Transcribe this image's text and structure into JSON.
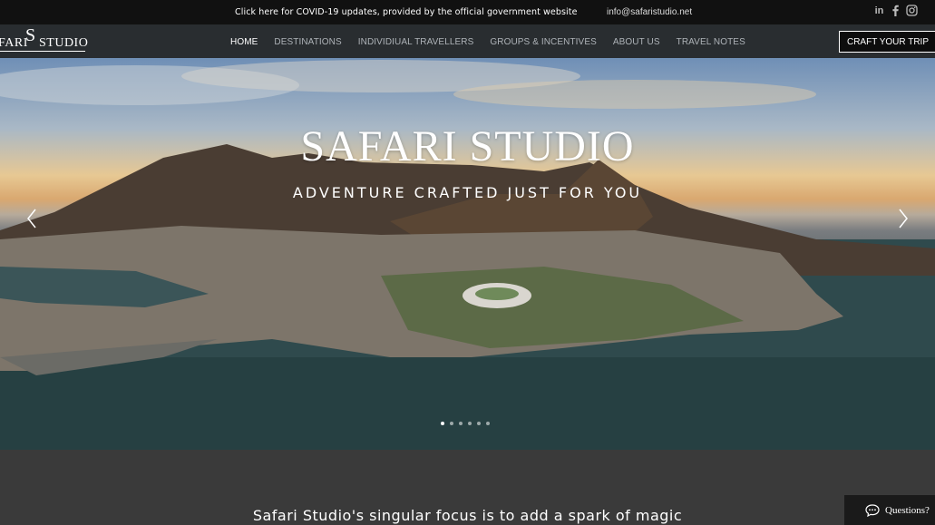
{
  "topbar": {
    "covid_text": "Click here for COVID-19 updates, provided by the official government website",
    "email": "info@safaristudio.net",
    "social": [
      "linkedin-icon",
      "facebook-icon",
      "instagram-icon"
    ]
  },
  "logo": {
    "initial": "S",
    "word1": "FARI",
    "word2": "STUDIO"
  },
  "nav": {
    "items": [
      "HOME",
      "DESTINATIONS",
      "INDIVIDIUAL TRAVELLERS",
      "GROUPS & INCENTIVES",
      "ABOUT US",
      "TRAVEL NOTES"
    ],
    "active_index": 0,
    "cta": "CRAFT YOUR TRIP"
  },
  "hero": {
    "title": "SAFARI STUDIO",
    "subtitle": "ADVENTURE CRAFTED JUST FOR YOU",
    "slide_count": 6,
    "active_slide": 0
  },
  "intro": {
    "text": "Safari Studio's singular focus is to add a spark of magic"
  },
  "chat": {
    "label": "Questions?"
  },
  "colors": {
    "topbar": "#111111",
    "nav": "#2c3034",
    "section": "#3a3a3a"
  }
}
